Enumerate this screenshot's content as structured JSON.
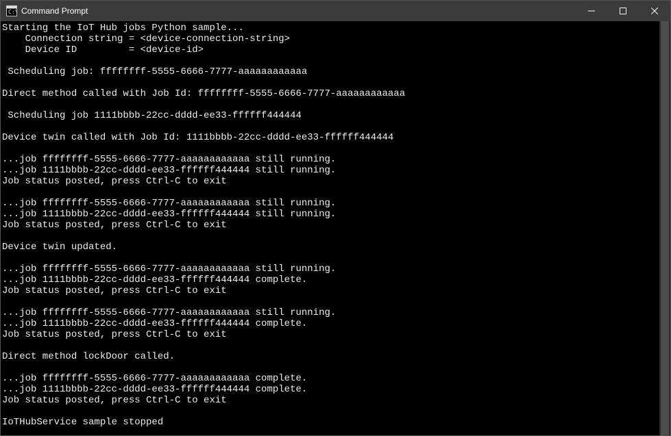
{
  "window": {
    "title": "Command Prompt"
  },
  "console": {
    "lines": [
      "Starting the IoT Hub jobs Python sample...",
      "    Connection string = <device-connection-string>",
      "    Device ID         = <device-id>",
      "",
      " Scheduling job: ffffffff-5555-6666-7777-aaaaaaaaaaaa",
      "",
      "Direct method called with Job Id: ffffffff-5555-6666-7777-aaaaaaaaaaaa",
      "",
      " Scheduling job 1111bbbb-22cc-dddd-ee33-ffffff444444",
      "",
      "Device twin called with Job Id: 1111bbbb-22cc-dddd-ee33-ffffff444444",
      "",
      "...job ffffffff-5555-6666-7777-aaaaaaaaaaaa still running.",
      "...job 1111bbbb-22cc-dddd-ee33-ffffff444444 still running.",
      "Job status posted, press Ctrl-C to exit",
      "",
      "...job ffffffff-5555-6666-7777-aaaaaaaaaaaa still running.",
      "...job 1111bbbb-22cc-dddd-ee33-ffffff444444 still running.",
      "Job status posted, press Ctrl-C to exit",
      "",
      "Device twin updated.",
      "",
      "...job ffffffff-5555-6666-7777-aaaaaaaaaaaa still running.",
      "...job 1111bbbb-22cc-dddd-ee33-ffffff444444 complete.",
      "Job status posted, press Ctrl-C to exit",
      "",
      "...job ffffffff-5555-6666-7777-aaaaaaaaaaaa still running.",
      "...job 1111bbbb-22cc-dddd-ee33-ffffff444444 complete.",
      "Job status posted, press Ctrl-C to exit",
      "",
      "Direct method lockDoor called.",
      "",
      "...job ffffffff-5555-6666-7777-aaaaaaaaaaaa complete.",
      "...job 1111bbbb-22cc-dddd-ee33-ffffff444444 complete.",
      "Job status posted, press Ctrl-C to exit",
      "",
      "IoTHubService sample stopped"
    ]
  }
}
